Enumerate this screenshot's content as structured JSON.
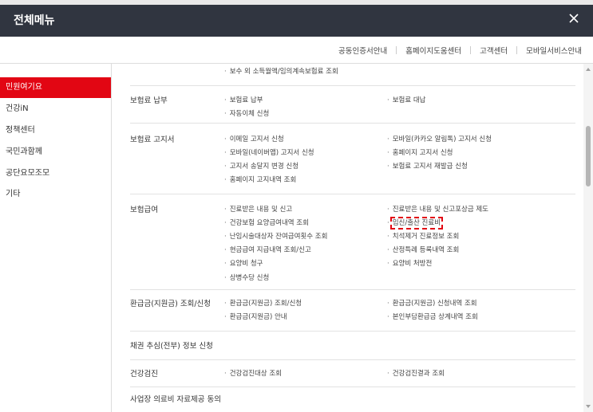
{
  "header": {
    "title": "전체메뉴"
  },
  "utility_links": [
    "공동인증서안내",
    "홈페이지도움센터",
    "고객센터",
    "모바일서비스안내"
  ],
  "sidebar": {
    "items": [
      {
        "label": "민원여기요",
        "active": true
      },
      {
        "label": "건강iN",
        "active": false
      },
      {
        "label": "정책센터",
        "active": false
      },
      {
        "label": "국민과함께",
        "active": false
      },
      {
        "label": "공단요모조모",
        "active": false
      },
      {
        "label": "기타",
        "active": false
      }
    ]
  },
  "rows": [
    {
      "category": "",
      "left": [
        "보수 외 소득월액/임의계속보험료 조회"
      ],
      "right": []
    },
    {
      "category": "보험료 납부",
      "left": [
        "보험료 납부",
        "자동이체 신청"
      ],
      "right": [
        "보험료 대납"
      ]
    },
    {
      "category": "보험료 고지서",
      "left": [
        "이메일 고지서 신청",
        "모바일(네이버앱) 고지서 신청",
        "고지서 송달지 변경 신청",
        "홈페이지 고지내역 조회"
      ],
      "right": [
        "모바일(카카오 알림톡) 고지서 신청",
        "홈페이지 고지서 신청",
        "보험료 고지서 재발급 신청"
      ]
    },
    {
      "category": "보험급여",
      "left": [
        "진료받은 내용 및 신고",
        "건강보험 요양급여내역 조회",
        "난임시술대상자 잔여급여횟수 조회",
        "현금급여 지급내역 조회/신고",
        "요양비 청구",
        "상병수당 신청"
      ],
      "right": [
        "진료받은 내용 및 신고포상금 제도",
        "임신/출산 진료비",
        "치석제거 진료정보 조회",
        "산정특례 등록내역 조회",
        "요양비 처방전"
      ]
    },
    {
      "category": "환급금(지원금) 조회/신청",
      "left": [
        "환급금(지원금) 조회/신청",
        "환급금(지원금) 안내"
      ],
      "right": [
        "환급금(지원금) 신청내역 조회",
        "본인부담환급금 상계내역 조회"
      ]
    },
    {
      "category": "채권 추심(전부) 정보 신청",
      "left": [],
      "right": []
    },
    {
      "category": "건강검진",
      "left": [
        "건강검진대상 조회"
      ],
      "right": [
        "건강검진결과 조회"
      ]
    },
    {
      "category": "사업장 의료비 자료제공 동의",
      "left": [],
      "right": []
    }
  ],
  "colors": {
    "accent": "#e20613",
    "titlebar": "#303540"
  }
}
